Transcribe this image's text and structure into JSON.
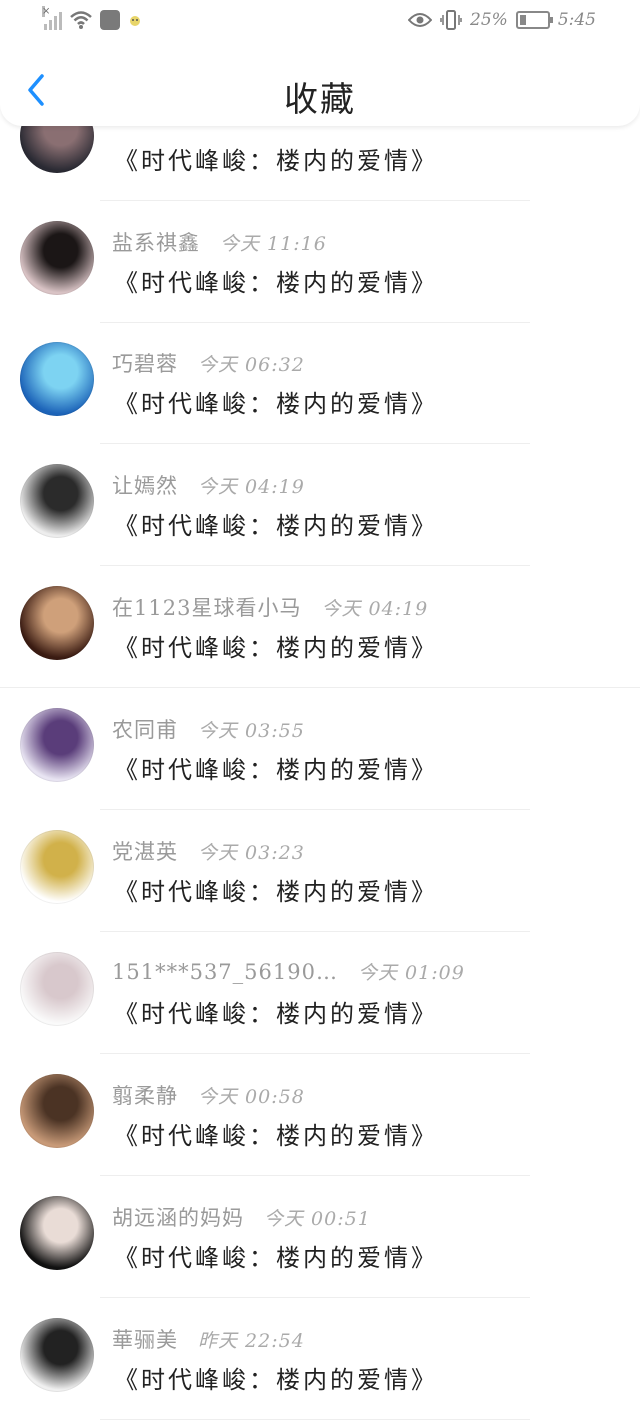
{
  "status": {
    "battery": "25%",
    "time": "5:45"
  },
  "nav": {
    "title": "收藏"
  },
  "accent": "#1e90ff",
  "items": [
    {
      "name": "",
      "time": "",
      "title": "《时代峰峻：楼内的爱情》",
      "avatar_colors": [
        "#2a2a33",
        "#8a6f72"
      ]
    },
    {
      "name": "盐系祺鑫",
      "time": "今天 11:16",
      "title": "《时代峰峻：楼内的爱情》",
      "avatar_colors": [
        "#d9c3c5",
        "#1b1616"
      ]
    },
    {
      "name": "巧碧蓉",
      "time": "今天 06:32",
      "title": "《时代峰峻：楼内的爱情》",
      "avatar_colors": [
        "#1c63b8",
        "#7dd3f2"
      ]
    },
    {
      "name": "让嫣然",
      "time": "今天 04:19",
      "title": "《时代峰峻：楼内的爱情》",
      "avatar_colors": [
        "#ededed",
        "#2b2b2b"
      ]
    },
    {
      "name": "在1123星球看小马",
      "time": "今天 04:19",
      "title": "《时代峰峻：楼内的爱情》",
      "avatar_colors": [
        "#3a1b12",
        "#cfa07a"
      ]
    },
    {
      "name": "农同甫",
      "time": "今天 03:55",
      "title": "《时代峰峻：楼内的爱情》",
      "avatar_colors": [
        "#e8e4f2",
        "#5a3d7a"
      ]
    },
    {
      "name": "党湛英",
      "time": "今天 03:23",
      "title": "《时代峰峻：楼内的爱情》",
      "avatar_colors": [
        "#ffffff",
        "#d1b14a"
      ]
    },
    {
      "name": "151***537_56190…",
      "time": "今天 01:09",
      "title": "《时代峰峻：楼内的爱情》",
      "avatar_colors": [
        "#fafafa",
        "#d8c8cc"
      ]
    },
    {
      "name": "翦柔静",
      "time": "今天 00:58",
      "title": "《时代峰峻：楼内的爱情》",
      "avatar_colors": [
        "#c89a78",
        "#4b3324"
      ]
    },
    {
      "name": "胡远涵的妈妈",
      "time": "今天 00:51",
      "title": "《时代峰峻：楼内的爱情》",
      "avatar_colors": [
        "#111111",
        "#e9dcd6"
      ]
    },
    {
      "name": "華骊美",
      "time": "昨天 22:54",
      "title": "《时代峰峻：楼内的爱情》",
      "avatar_colors": [
        "#f0f0f0",
        "#222222"
      ]
    }
  ]
}
